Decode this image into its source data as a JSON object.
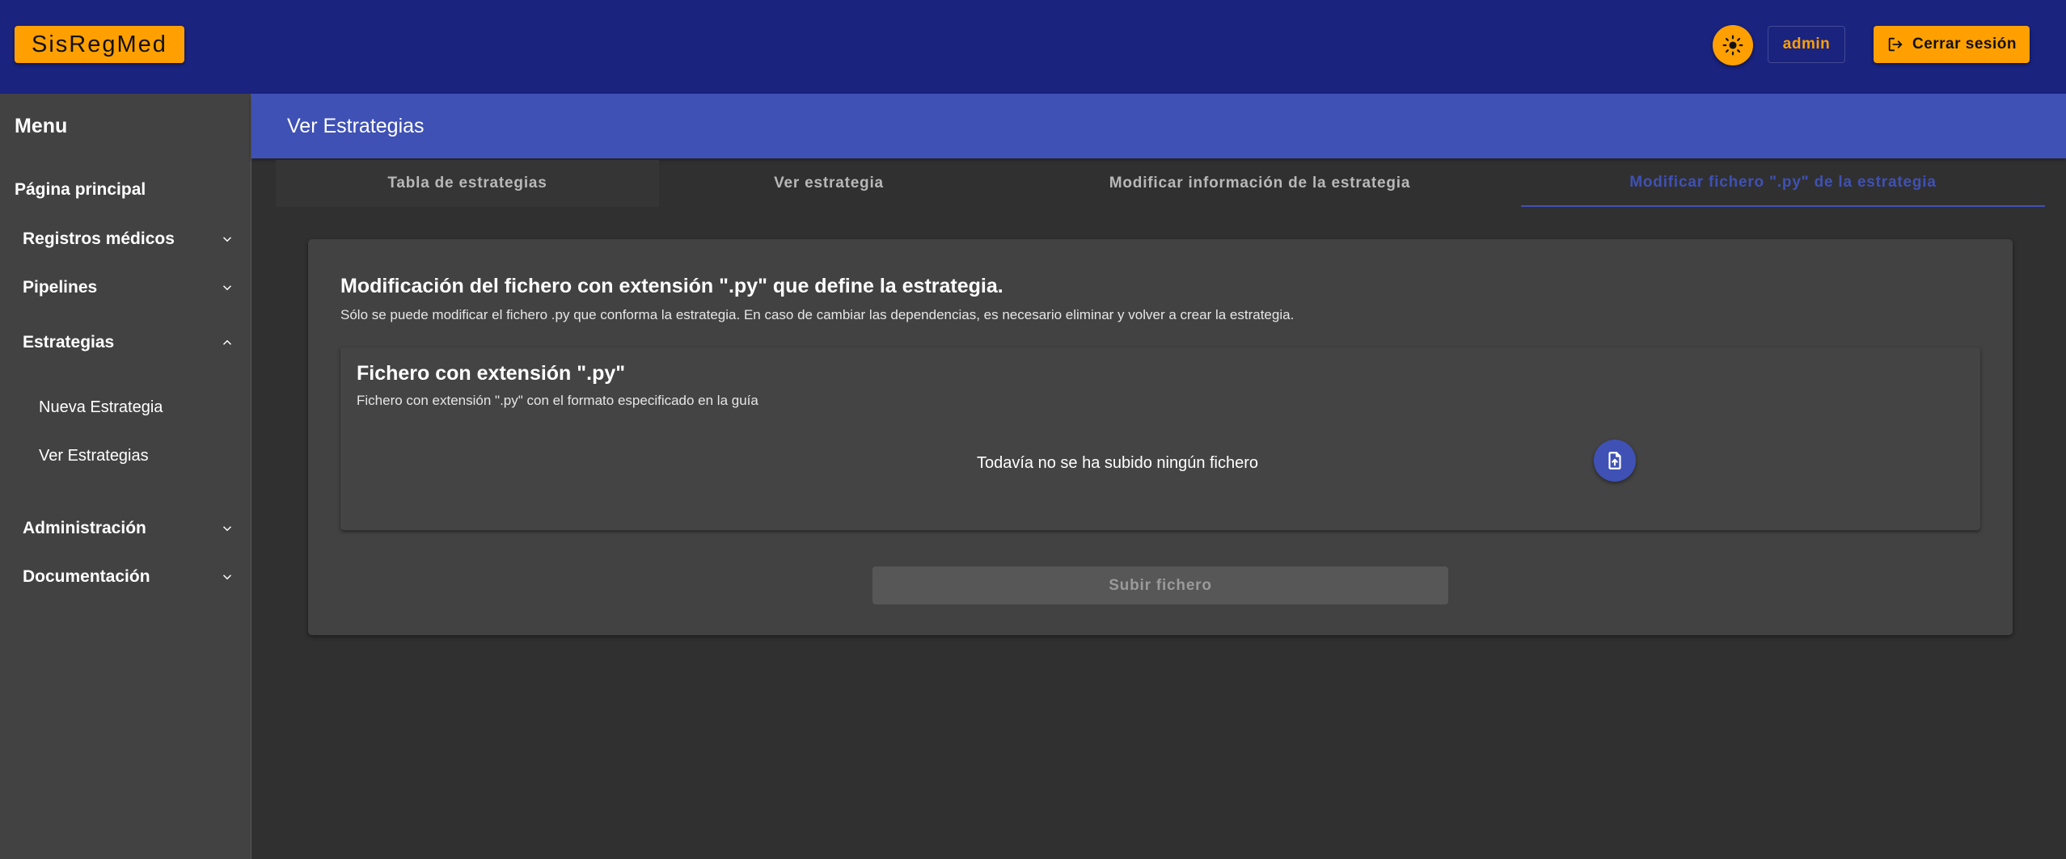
{
  "header": {
    "brand": "SisRegMed",
    "theme_toggle_icon": "sun-icon",
    "user_label": "admin",
    "logout_label": "Cerrar sesión",
    "logout_icon": "logout-icon",
    "colors": {
      "appbar": "#1a237e",
      "accent": "#ffa000",
      "primary": "#3f51b5"
    }
  },
  "sidebar": {
    "title": "Menu",
    "home": "Página principal",
    "items": [
      {
        "label": "Registros médicos",
        "expanded": false
      },
      {
        "label": "Pipelines",
        "expanded": false
      },
      {
        "label": "Estrategias",
        "expanded": true,
        "children": [
          "Nueva Estrategia",
          "Ver Estrategias"
        ]
      },
      {
        "label": "Administración",
        "expanded": false
      },
      {
        "label": "Documentación",
        "expanded": false
      }
    ]
  },
  "page": {
    "title": "Ver Estrategias",
    "tabs": [
      {
        "label": "Tabla de estrategias",
        "active": false
      },
      {
        "label": "Ver estrategia",
        "active": false
      },
      {
        "label": "Modificar información de la estrategia",
        "active": false
      },
      {
        "label": "Modificar fichero \".py\" de la estrategia",
        "active": true
      }
    ],
    "card": {
      "title": "Modificación del fichero con extensión \".py\" que define la estrategia.",
      "description": "Sólo se puede modificar el fichero .py que conforma la estrategia. En caso de cambiar las dependencias, es necesario eliminar y volver a crear la estrategia.",
      "file_section": {
        "title": "Fichero con extensión \".py\"",
        "description": "Fichero con extensión \".py\" con el formato especificado en la guía",
        "status": "Todavía no se ha subido ningún fichero",
        "upload_icon": "file-upload-icon"
      },
      "submit_label": "Subir fichero"
    }
  }
}
